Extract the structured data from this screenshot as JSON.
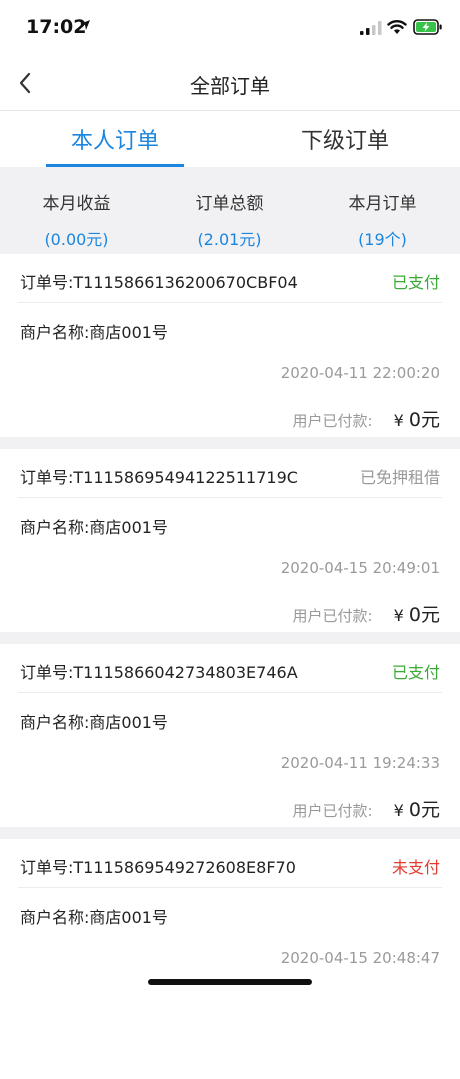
{
  "status_bar": {
    "time": "17:02"
  },
  "nav": {
    "title": "全部订单"
  },
  "tabs": [
    {
      "label": "本人订单",
      "active": true
    },
    {
      "label": "下级订单",
      "active": false
    }
  ],
  "stats": [
    {
      "label": "本月收益",
      "value": "(0.00元)"
    },
    {
      "label": "订单总额",
      "value": "(2.01元)"
    },
    {
      "label": "本月订单",
      "value": "(19个)"
    }
  ],
  "colors": {
    "accent": "#1a86e0",
    "status_paid": "#3aaa35",
    "status_deposit_free": "#9a9a9a",
    "status_unpaid": "#e23b2e"
  },
  "orders": [
    {
      "order_no": "订单号:T1115866136200670CBF04",
      "status": "已支付",
      "status_color": "#3aaa35",
      "merchant": "商户名称:商店001号",
      "time": "2020-04-11 22:00:20",
      "paid_label": "用户已付款:",
      "currency": "¥",
      "amount": "0元"
    },
    {
      "order_no": "订单号:T1115869549412251171 9C",
      "status": "已免押租借",
      "status_color": "#9a9a9a",
      "merchant": "商户名称:商店001号",
      "time": "2020-04-15 20:49:01",
      "paid_label": "用户已付款:",
      "currency": "¥",
      "amount": "0元"
    },
    {
      "order_no": "订单号:T1115866042734803E746A",
      "status": "已支付",
      "status_color": "#3aaa35",
      "merchant": "商户名称:商店001号",
      "time": "2020-04-11 19:24:33",
      "paid_label": "用户已付款:",
      "currency": "¥",
      "amount": "0元"
    },
    {
      "order_no": "订单号:T1115869549272608E8F70",
      "status": "未支付",
      "status_color": "#e23b2e",
      "merchant": "商户名称:商店001号",
      "time": "2020-04-15 20:48:47",
      "paid_label": "",
      "currency": "",
      "amount": ""
    }
  ]
}
